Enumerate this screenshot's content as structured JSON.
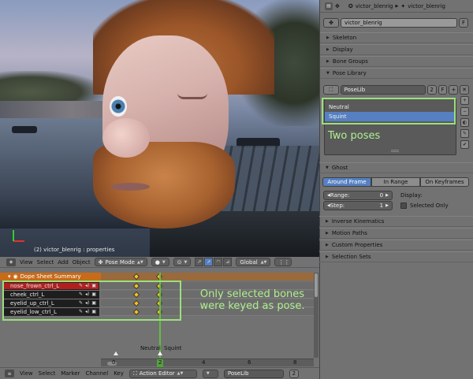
{
  "viewport": {
    "object_label": "(2) victor_blenrig : properties",
    "header": {
      "menu_view": "View",
      "menu_select": "Select",
      "menu_add": "Add",
      "menu_object": "Object",
      "mode": "Pose Mode",
      "orientation": "Global"
    }
  },
  "dopesheet": {
    "summary": "Dope Sheet Summary",
    "channels": [
      {
        "name": "nose_frown_ctrl_L",
        "active": true
      },
      {
        "name": "cheek_ctrl_L",
        "active": false
      },
      {
        "name": "eyelid_up_ctrl_L",
        "active": false
      },
      {
        "name": "eyelid_low_ctrl_L",
        "active": false
      }
    ],
    "markers": [
      "Neutral",
      "Squint"
    ],
    "ruler": [
      "0",
      "2",
      "4",
      "6",
      "8"
    ],
    "current_frame": "2",
    "annotation": "Only selected bones were keyed as pose."
  },
  "bottom_header": {
    "menu_view": "View",
    "menu_select": "Select",
    "menu_marker": "Marker",
    "menu_channel": "Channel",
    "menu_key": "Key",
    "editor_mode": "Action Editor",
    "action_name": "PoseLib",
    "action_users": "2"
  },
  "properties": {
    "breadcrumb_object": "victor_blenrig",
    "breadcrumb_data": "victor_blenrig",
    "armature_name": "victor_blenrig",
    "fake_user": "F",
    "panels": {
      "skeleton": "Skeleton",
      "display": "Display",
      "bone_groups": "Bone Groups",
      "pose_library": "Pose Library",
      "ghost": "Ghost",
      "inverse_kinematics": "Inverse Kinematics",
      "motion_paths": "Motion Paths",
      "custom_properties": "Custom Properties",
      "selection_sets": "Selection Sets"
    },
    "poselib": {
      "name": "PoseLib",
      "users": "2",
      "fake": "F",
      "poses": [
        "Neutral",
        "Squint"
      ],
      "annotation": "Two poses"
    },
    "ghost": {
      "modes": [
        "Around Frame",
        "In Range",
        "On Keyframes"
      ],
      "active_mode": "Around Frame",
      "range_label": "Range:",
      "range_value": "0",
      "step_label": "Step:",
      "step_value": "1",
      "display_label": "Display:",
      "selected_only": "Selected Only"
    }
  },
  "colors": {
    "accent_blue": "#5680c2",
    "annotation_green": "#9be07b",
    "keyframe_yellow": "#f0c020",
    "active_channel_red": "#b11f1f"
  }
}
